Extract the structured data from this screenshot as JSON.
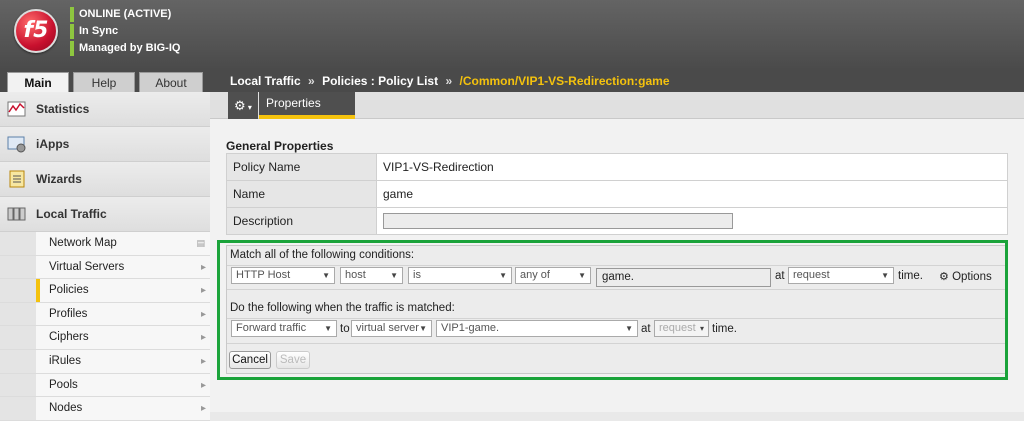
{
  "header": {
    "logo_text": "f5",
    "status_lines": [
      "ONLINE (ACTIVE)",
      "In Sync",
      "Managed by BIG-IQ"
    ],
    "status_color": "#8ec63f"
  },
  "main_tabs": [
    "Main",
    "Help",
    "About"
  ],
  "sidebar": {
    "items": [
      {
        "label": "Statistics",
        "icon": "statistics-icon"
      },
      {
        "label": "iApps",
        "icon": "iapps-icon"
      },
      {
        "label": "Wizards",
        "icon": "wizards-icon"
      },
      {
        "label": "Local Traffic",
        "icon": "local-traffic-icon"
      }
    ],
    "local_traffic_sub": [
      "Network Map",
      "Virtual Servers",
      "Policies",
      "Profiles",
      "Ciphers",
      "iRules",
      "Pools",
      "Nodes"
    ],
    "active_sub": "Policies"
  },
  "breadcrumb": {
    "part1": "Local Traffic",
    "sep": "»",
    "part2": "Policies : Policy List",
    "current": "/Common/VIP1-VS-Redirection:game"
  },
  "subtabs": {
    "properties_label": "Properties",
    "gear_icon": "gear-icon"
  },
  "general": {
    "title": "General Properties",
    "rows": [
      {
        "key": "Policy Name",
        "value": "VIP1-VS-Redirection"
      },
      {
        "key": "Name",
        "value": "game"
      },
      {
        "key": "Description",
        "value": ""
      }
    ]
  },
  "conditions": {
    "title": "Match all of the following conditions:",
    "selects": [
      "HTTP Host",
      "host",
      "is",
      "any of"
    ],
    "value": "game.",
    "at_label": "at",
    "at_value": "request",
    "time_label": "time.",
    "options_label": "Options"
  },
  "actions": {
    "title": "Do the following when the traffic is matched:",
    "action": "Forward traffic",
    "to_label": "to",
    "target_type": "virtual server",
    "target": "VIP1-game.",
    "at_label": "at",
    "at_value": "request",
    "time_label": "time."
  },
  "buttons": {
    "cancel": "Cancel",
    "save": "Save"
  },
  "accent": "#f4c20d",
  "highlight": "#1aa33a"
}
